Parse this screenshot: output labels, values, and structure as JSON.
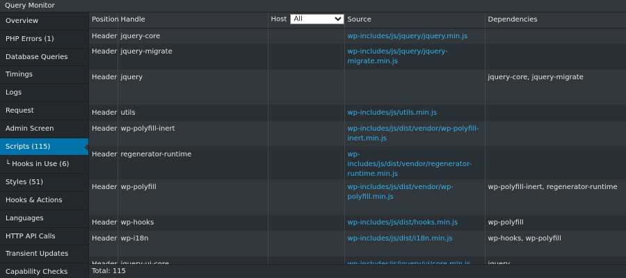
{
  "window": {
    "title": "Query Monitor"
  },
  "sidebar": {
    "items": [
      {
        "label": "Overview",
        "name": "sidebar-item-overview"
      },
      {
        "label": "PHP Errors (1)",
        "name": "sidebar-item-php-errors"
      },
      {
        "label": "Database Queries",
        "name": "sidebar-item-database-queries"
      },
      {
        "label": "Timings",
        "name": "sidebar-item-timings"
      },
      {
        "label": "Logs",
        "name": "sidebar-item-logs"
      },
      {
        "label": "Request",
        "name": "sidebar-item-request"
      },
      {
        "label": "Admin Screen",
        "name": "sidebar-item-admin-screen"
      },
      {
        "label": "Scripts (115)",
        "name": "sidebar-item-scripts",
        "active": true
      },
      {
        "label": "└ Hooks in Use (6)",
        "name": "sidebar-item-hooks-in-use"
      },
      {
        "label": "Styles (51)",
        "name": "sidebar-item-styles"
      },
      {
        "label": "Hooks & Actions",
        "name": "sidebar-item-hooks-actions"
      },
      {
        "label": "Languages",
        "name": "sidebar-item-languages"
      },
      {
        "label": "HTTP API Calls",
        "name": "sidebar-item-http-api-calls"
      },
      {
        "label": "Transient Updates",
        "name": "sidebar-item-transient-updates"
      },
      {
        "label": "Capability Checks",
        "name": "sidebar-item-capability-checks"
      }
    ]
  },
  "table": {
    "headers": {
      "position": "Position",
      "handle": "Handle",
      "host": "Host",
      "source": "Source",
      "dependencies": "Dependencies"
    },
    "host_filter": {
      "selected": "All"
    },
    "rows": [
      {
        "position": "Header",
        "handle": "jquery-core",
        "host": "",
        "source": "wp-includes/js/jquery/jquery.min.js",
        "dependencies": "",
        "height": 23
      },
      {
        "position": "Header",
        "handle": "jquery-migrate",
        "host": "",
        "source": "wp-includes/js/jquery/jquery-migrate.min.js",
        "dependencies": "",
        "height": 37
      },
      {
        "position": "Header",
        "handle": "jquery",
        "host": "",
        "source": "",
        "dependencies": "jquery-core, jquery-migrate",
        "height": 51
      },
      {
        "position": "Header",
        "handle": "utils",
        "host": "",
        "source": "wp-includes/js/utils.min.js",
        "dependencies": "",
        "height": 23
      },
      {
        "position": "Header",
        "handle": "wp-polyfill-inert",
        "host": "",
        "source": "wp-includes/js/dist/vendor/wp-polyfill-inert.min.js",
        "dependencies": "",
        "height": 37
      },
      {
        "position": "Header",
        "handle": "regenerator-runtime",
        "host": "",
        "source": "wp-includes/js/dist/vendor/regenerator-runtime.min.js",
        "dependencies": "",
        "height": 37
      },
      {
        "position": "Header",
        "handle": "wp-polyfill",
        "host": "",
        "source": "wp-includes/js/dist/vendor/wp-polyfill.min.js",
        "dependencies": "wp-polyfill-inert, regenerator-runtime",
        "height": 51
      },
      {
        "position": "Header",
        "handle": "wp-hooks",
        "host": "",
        "source": "wp-includes/js/dist/hooks.min.js",
        "dependencies": "wp-polyfill",
        "height": 23
      },
      {
        "position": "Header",
        "handle": "wp-i18n",
        "host": "",
        "source": "wp-includes/js/dist/i18n.min.js",
        "dependencies": "wp-hooks, wp-polyfill",
        "height": 37
      },
      {
        "position": "Header",
        "handle": "jquery-ui-core",
        "host": "",
        "source": "wp-includes/js/jquery/ui/core.min.js",
        "dependencies": "jquery",
        "height": 23
      }
    ]
  },
  "footer": {
    "total": "Total: 115"
  }
}
